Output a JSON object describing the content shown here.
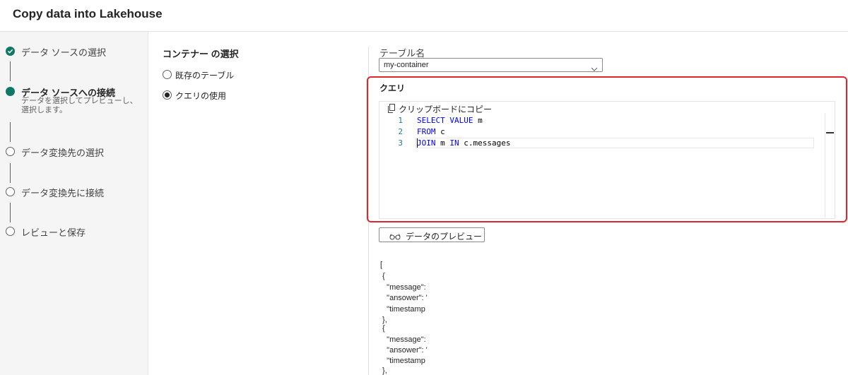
{
  "header": {
    "title": "Copy data into Lakehouse"
  },
  "wizard": {
    "steps": [
      {
        "label": "データ ソースの選択",
        "state": "done"
      },
      {
        "label": "データ ソースへの接続",
        "state": "current",
        "description": "データを選択してプレビューし、選択します。"
      },
      {
        "label": "データ変換先の選択",
        "state": "pending"
      },
      {
        "label": "データ変換先に接続",
        "state": "pending"
      },
      {
        "label": "レビューと保存",
        "state": "pending"
      }
    ]
  },
  "container": {
    "title": "コンテナー の選択",
    "options": [
      {
        "label": "既存のテーブル",
        "selected": false
      },
      {
        "label": "クエリの使用",
        "selected": true
      }
    ]
  },
  "table": {
    "label": "テーブル名",
    "selected": "my-container"
  },
  "query": {
    "title": "クエリ",
    "copy_label": "クリップボードにコピー",
    "lines": [
      {
        "no": "1",
        "kw1": "SELECT VALUE",
        "rest": " m"
      },
      {
        "no": "2",
        "kw1": "FROM",
        "rest": " c"
      },
      {
        "no": "3",
        "kw1": "JOIN",
        "mid": " m ",
        "kw2": "IN",
        "rest": " c.messages"
      }
    ]
  },
  "preview": {
    "button_label": "データのプレビュー",
    "json_lines": [
      "[",
      " {",
      "   \"message\":",
      "   \"ansower\": '",
      "   \"timestamp",
      " },",
      " {",
      "   \"message\":",
      "   \"ansower\": '",
      "   \"timestamp",
      " },"
    ]
  },
  "colors": {
    "accent": "#117865",
    "highlight": "#e0262d",
    "keyword": "#0000ff",
    "line_number": "#237893"
  }
}
